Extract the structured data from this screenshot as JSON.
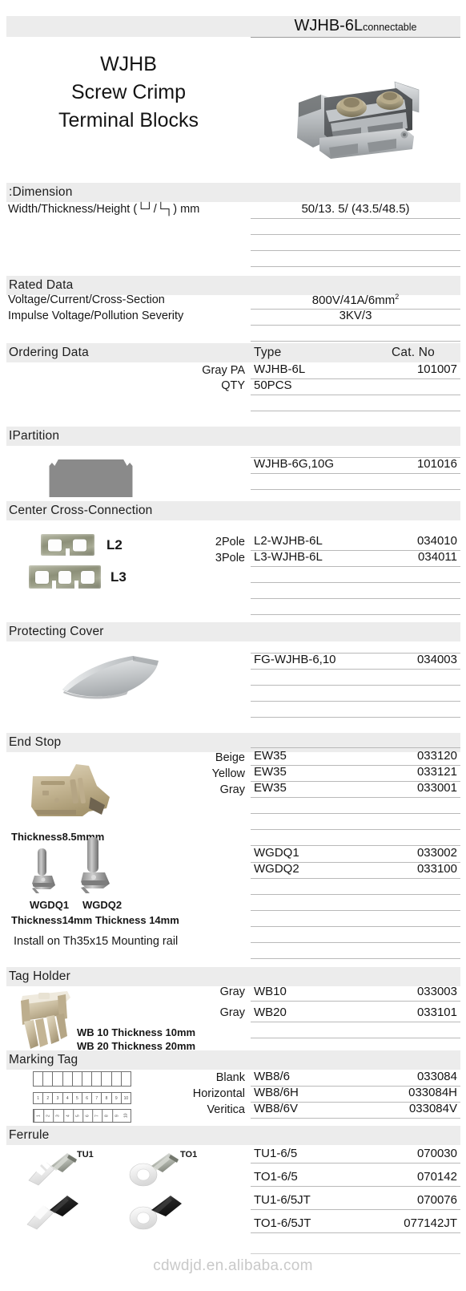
{
  "header": {
    "product_code": "WJHB-6L",
    "product_code_suffix": "connectable",
    "title_line1": "WJHB",
    "title_line2": "Screw Crimp",
    "title_line3": "Terminal Blocks",
    "hero_image": "terminal-block-photo"
  },
  "sections": {
    "dimension": {
      "title": ":Dimension",
      "row_label": "Width/Thickness/Height  (└┘/└┐) mm",
      "value": "50/13. 5/ (43.5/48.5)"
    },
    "rated_data": {
      "title": "Rated  Data",
      "rows": [
        {
          "label": "Voltage/Current/Cross-Section",
          "value": "800V/41A/6mm",
          "sup": "2"
        },
        {
          "label": "Impulse Voltage/Pollution Severity",
          "value": "3KV/3",
          "sup": ""
        }
      ]
    },
    "ordering_data": {
      "title": "Ordering Data",
      "col_type": "Type",
      "col_cat": "Cat. No",
      "rows": [
        {
          "left": "Gray PA",
          "type": "WJHB-6L",
          "cat": "101007"
        },
        {
          "left": "QTY",
          "type": "50PCS",
          "cat": ""
        }
      ]
    },
    "partition": {
      "title": "IPartition",
      "image": "partition-plate",
      "rows": [
        {
          "type": "WJHB-6G,10G",
          "cat": "101016"
        }
      ]
    },
    "center_cross_connection": {
      "title": "Center Cross-Connection",
      "image_l2_label": "L2",
      "image_l3_label": "L3",
      "rows": [
        {
          "left": "2Pole",
          "type": "L2-WJHB-6L",
          "cat": "034010"
        },
        {
          "left": "3Pole",
          "type": "L3-WJHB-6L",
          "cat": "034011"
        }
      ]
    },
    "protecting_cover": {
      "title": "Protecting Cover",
      "image": "protecting-cover-photo",
      "rows": [
        {
          "type": "FG-WJHB-6,10",
          "cat": "034003"
        }
      ]
    },
    "end_stop": {
      "title": "End Stop",
      "image": "end-stop-photo",
      "note_thickness": "Thickness8.5mmm",
      "rows": [
        {
          "left": "Beige",
          "type": "EW35",
          "cat": "033120"
        },
        {
          "left": "Yellow",
          "type": "EW35",
          "cat": "033121"
        },
        {
          "left": "Gray",
          "type": "EW35",
          "cat": "033001"
        }
      ],
      "clip_rows": [
        {
          "type": "WGDQ1",
          "cat": "033002"
        },
        {
          "type": "WGDQ2",
          "cat": "033100"
        }
      ],
      "clip1_label": "WGDQ1",
      "clip2_label": "WGDQ2",
      "clip1_thickness": "Thickness14mm",
      "clip2_thickness": "Thickness 14mm",
      "install_note": "Install on Th35x15 Mounting rail"
    },
    "tag_holder": {
      "title": "Tag Holder",
      "image": "tag-holder-photo",
      "note1": "WB 10 Thickness 10mm",
      "note2": "WB 20 Thickness 20mm",
      "rows": [
        {
          "left": "Gray",
          "type": "WB10",
          "cat": "033003"
        },
        {
          "left": "Gray",
          "type": "WB20",
          "cat": "033101"
        }
      ]
    },
    "marking_tag": {
      "title": "Marking Tag",
      "strip_blank_cells": [
        "",
        "",
        "",
        "",
        "",
        "",
        "",
        "",
        "",
        ""
      ],
      "strip_horizontal_cells": [
        "1",
        "2",
        "3",
        "4",
        "5",
        "6",
        "7",
        "8",
        "9",
        "10"
      ],
      "strip_vertical_cells": [
        "1",
        "2",
        "3",
        "4",
        "5",
        "6",
        "7",
        "8",
        "9",
        "10"
      ],
      "rows": [
        {
          "left": "Blank",
          "type": "WB8/6",
          "cat": "033084"
        },
        {
          "left": "Horizontal",
          "type": "WB8/6H",
          "cat": "033084H"
        },
        {
          "left": "Veritica",
          "type": "WB8/6V",
          "cat": "033084V"
        }
      ]
    },
    "ferrule": {
      "title": "Ferrule",
      "image_tu1_label": "TU1",
      "image_to1_label": "TO1",
      "rows": [
        {
          "type": "TU1-6/5",
          "cat": "070030"
        },
        {
          "type": "TO1-6/5",
          "cat": "070142"
        },
        {
          "type": "TU1-6/5JT",
          "cat": "070076"
        },
        {
          "type": "TO1-6/5JT",
          "cat": "077142JT"
        }
      ]
    }
  },
  "footer": {
    "watermark": "cdwdjd.en.alibaba.com"
  }
}
